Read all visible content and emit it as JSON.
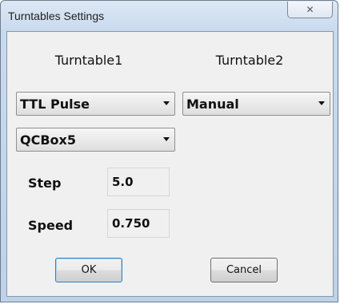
{
  "window": {
    "title": "Turntables Settings",
    "close_glyph": "✕",
    "close_icon": "close-icon"
  },
  "turntable1": {
    "heading": "Turntable1",
    "mode": "TTL Pulse",
    "device": "QCBox5"
  },
  "turntable2": {
    "heading": "Turntable2",
    "mode": "Manual"
  },
  "params": {
    "step_label": "Step",
    "step_value": "5.0",
    "speed_label": "Speed",
    "speed_value": "0.750"
  },
  "buttons": {
    "ok": "OK",
    "cancel": "Cancel"
  },
  "colors": {
    "title_bar": "#c9daee",
    "client_bg": "#f0f0f0"
  }
}
